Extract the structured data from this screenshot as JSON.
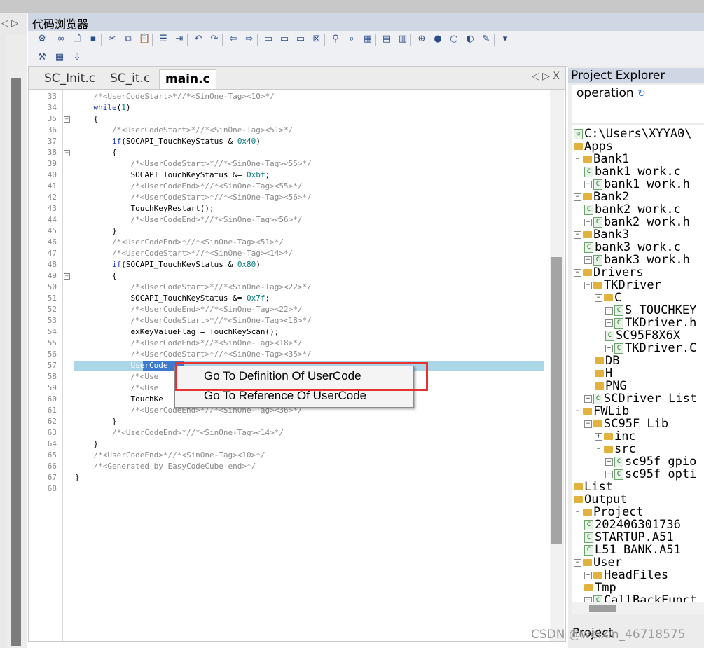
{
  "window": {
    "title": "代码浏览器",
    "left_nav_arrows": "◁ ▷"
  },
  "editor": {
    "tabs": [
      {
        "label": "SC_Init.c",
        "active": false
      },
      {
        "label": "SC_it.c",
        "active": false
      },
      {
        "label": "main.c",
        "active": true
      }
    ],
    "tab_controls": "◁ ▷ X",
    "lines": [
      {
        "n": "33",
        "fold": "",
        "code": "    /*<UserCodeStart>*//*<SinOne-Tag><10>*/"
      },
      {
        "n": "34",
        "fold": "",
        "code": "    while(1)"
      },
      {
        "n": "35",
        "fold": "−",
        "code": "    {"
      },
      {
        "n": "36",
        "fold": "",
        "code": "        /*<UserCodeStart>*//*<SinOne-Tag><51>*/"
      },
      {
        "n": "37",
        "fold": "",
        "code": "        if(SOCAPI_TouchKeyStatus & 0x40)"
      },
      {
        "n": "38",
        "fold": "−",
        "code": "        {"
      },
      {
        "n": "39",
        "fold": "",
        "code": "            /*<UserCodeStart>*//*<SinOne-Tag><55>*/"
      },
      {
        "n": "40",
        "fold": "",
        "code": "            SOCAPI_TouchKeyStatus &= 0xbf;"
      },
      {
        "n": "41",
        "fold": "",
        "code": "            /*<UserCodeEnd>*//*<SinOne-Tag><55>*/"
      },
      {
        "n": "42",
        "fold": "",
        "code": "            /*<UserCodeStart>*//*<SinOne-Tag><56>*/"
      },
      {
        "n": "43",
        "fold": "",
        "code": "            TouchKeyRestart();"
      },
      {
        "n": "44",
        "fold": "",
        "code": "            /*<UserCodeEnd>*//*<SinOne-Tag><56>*/"
      },
      {
        "n": "45",
        "fold": "",
        "code": "        }"
      },
      {
        "n": "46",
        "fold": "",
        "code": "        /*<UserCodeEnd>*//*<SinOne-Tag><51>*/"
      },
      {
        "n": "47",
        "fold": "",
        "code": "        /*<UserCodeStart>*//*<SinOne-Tag><14>*/"
      },
      {
        "n": "48",
        "fold": "",
        "code": "        if(SOCAPI_TouchKeyStatus & 0x80)"
      },
      {
        "n": "49",
        "fold": "−",
        "code": "        {"
      },
      {
        "n": "50",
        "fold": "",
        "code": "            /*<UserCodeStart>*//*<SinOne-Tag><22>*/"
      },
      {
        "n": "51",
        "fold": "",
        "code": "            SOCAPI_TouchKeyStatus &= 0x7f;"
      },
      {
        "n": "52",
        "fold": "",
        "code": "            /*<UserCodeEnd>*//*<SinOne-Tag><22>*/"
      },
      {
        "n": "53",
        "fold": "",
        "code": "            /*<UserCodeStart>*//*<SinOne-Tag><18>*/"
      },
      {
        "n": "54",
        "fold": "",
        "code": "            exKeyValueFlag = TouchKeyScan();"
      },
      {
        "n": "55",
        "fold": "",
        "code": "            /*<UserCodeEnd>*//*<SinOne-Tag><18>*/"
      },
      {
        "n": "56",
        "fold": "",
        "code": "            /*<UserCodeStart>*//*<SinOne-Tag><35>*/"
      },
      {
        "n": "57",
        "fold": "",
        "code": "            UserCode"
      },
      {
        "n": "58",
        "fold": "",
        "code": "            /*<Use"
      },
      {
        "n": "59",
        "fold": "",
        "code": "            /*<Use"
      },
      {
        "n": "60",
        "fold": "",
        "code": "            TouchKe"
      },
      {
        "n": "61",
        "fold": "",
        "code": "            /*<UserCodeEnd>*//*<SinOne-Tag><36>*/"
      },
      {
        "n": "62",
        "fold": "",
        "code": "        }"
      },
      {
        "n": "63",
        "fold": "",
        "code": "        /*<UserCodeEnd>*//*<SinOne-Tag><14>*/"
      },
      {
        "n": "64",
        "fold": "",
        "code": "    }"
      },
      {
        "n": "65",
        "fold": "",
        "code": "    /*<UserCodeEnd>*//*<SinOne-Tag><10>*/"
      },
      {
        "n": "66",
        "fold": "",
        "code": "    /*<Generated by EasyCodeCube end>*/"
      },
      {
        "n": "67",
        "fold": "",
        "code": "}"
      },
      {
        "n": "68",
        "fold": "",
        "code": ""
      }
    ],
    "selected_word": "UserCode"
  },
  "context_menu": {
    "items": [
      {
        "label": "Go To Definition Of UserCode",
        "highlighted": true
      },
      {
        "label": "Go To Reference Of UserCode",
        "highlighted": false
      }
    ]
  },
  "project_explorer": {
    "title": "Project Explorer",
    "operation_label": "operation",
    "bottom_tab": "Project",
    "tree": [
      {
        "depth": 0,
        "type": "root",
        "toggle": "",
        "label": "C:\\Users\\XYYA0\\"
      },
      {
        "depth": 0,
        "type": "folder",
        "toggle": "",
        "label": "Apps"
      },
      {
        "depth": 0,
        "type": "folder",
        "toggle": "−",
        "label": "Bank1"
      },
      {
        "depth": 1,
        "type": "file",
        "toggle": "",
        "label": "bank1 work.c"
      },
      {
        "depth": 1,
        "type": "file",
        "toggle": "+",
        "label": "bank1 work.h"
      },
      {
        "depth": 0,
        "type": "folder",
        "toggle": "−",
        "label": "Bank2"
      },
      {
        "depth": 1,
        "type": "file",
        "toggle": "",
        "label": "bank2 work.c"
      },
      {
        "depth": 1,
        "type": "file",
        "toggle": "+",
        "label": "bank2 work.h"
      },
      {
        "depth": 0,
        "type": "folder",
        "toggle": "−",
        "label": "Bank3"
      },
      {
        "depth": 1,
        "type": "file",
        "toggle": "",
        "label": "bank3 work.c"
      },
      {
        "depth": 1,
        "type": "file",
        "toggle": "+",
        "label": "bank3 work.h"
      },
      {
        "depth": 0,
        "type": "folder",
        "toggle": "−",
        "label": "Drivers"
      },
      {
        "depth": 1,
        "type": "folder",
        "toggle": "−",
        "label": "TKDriver"
      },
      {
        "depth": 2,
        "type": "folder",
        "toggle": "−",
        "label": "C"
      },
      {
        "depth": 3,
        "type": "file",
        "toggle": "+",
        "label": "S TOUCHKEY"
      },
      {
        "depth": 3,
        "type": "file",
        "toggle": "+",
        "label": "TKDriver.h"
      },
      {
        "depth": 3,
        "type": "file",
        "toggle": "",
        "label": "SC95F8X6X"
      },
      {
        "depth": 3,
        "type": "file",
        "toggle": "+",
        "label": "TKDriver.C"
      },
      {
        "depth": 2,
        "type": "folder",
        "toggle": "",
        "label": "DB"
      },
      {
        "depth": 2,
        "type": "folder",
        "toggle": "",
        "label": "H"
      },
      {
        "depth": 2,
        "type": "folder",
        "toggle": "",
        "label": "PNG"
      },
      {
        "depth": 1,
        "type": "file",
        "toggle": "+",
        "label": "SCDriver List"
      },
      {
        "depth": 0,
        "type": "folder",
        "toggle": "−",
        "label": "FWLib"
      },
      {
        "depth": 1,
        "type": "folder",
        "toggle": "−",
        "label": "SC95F Lib"
      },
      {
        "depth": 2,
        "type": "folder",
        "toggle": "+",
        "label": "inc"
      },
      {
        "depth": 2,
        "type": "folder",
        "toggle": "−",
        "label": "src"
      },
      {
        "depth": 3,
        "type": "file",
        "toggle": "+",
        "label": "sc95f gpio"
      },
      {
        "depth": 3,
        "type": "file",
        "toggle": "+",
        "label": "sc95f opti"
      },
      {
        "depth": 0,
        "type": "folder",
        "toggle": "",
        "label": "List"
      },
      {
        "depth": 0,
        "type": "folder",
        "toggle": "",
        "label": "Output"
      },
      {
        "depth": 0,
        "type": "folder",
        "toggle": "−",
        "label": "Project"
      },
      {
        "depth": 1,
        "type": "file",
        "toggle": "",
        "label": "202406301736"
      },
      {
        "depth": 1,
        "type": "file",
        "toggle": "",
        "label": "STARTUP.A51"
      },
      {
        "depth": 1,
        "type": "file",
        "toggle": "",
        "label": "L51 BANK.A51"
      },
      {
        "depth": 0,
        "type": "folder",
        "toggle": "−",
        "label": "User"
      },
      {
        "depth": 1,
        "type": "folder",
        "toggle": "+",
        "label": "HeadFiles"
      },
      {
        "depth": 1,
        "type": "folder",
        "toggle": "",
        "label": "Tmp"
      },
      {
        "depth": 1,
        "type": "file",
        "toggle": "+",
        "label": "CallBackFunct"
      }
    ]
  },
  "toolbar": {
    "row1_icons": [
      "settings-icon",
      "link-icon",
      "new-file-icon",
      "save-icon",
      "cut-icon",
      "copy-icon",
      "paste-icon",
      "list-icon",
      "indent-icon",
      "undo-icon",
      "redo-icon",
      "arrow-left-icon",
      "arrow-right-icon",
      "comment-icon",
      "comment-icon",
      "comment-add-icon",
      "comment-remove-icon",
      "binoculars-icon",
      "find-icon",
      "find-in-files-icon",
      "window-icon",
      "window-split-icon",
      "search-zoom-icon",
      "dot-icon",
      "gray-dot-icon",
      "paint-icon",
      "tool-icon",
      "dropdown-icon"
    ],
    "row2_icons": [
      "build-icon",
      "grid-icon",
      "load-icon"
    ]
  },
  "watermark": "CSDN @weixin_46718575",
  "colors": {
    "accent": "#3d7bd0",
    "highlight_row": "#abd6e8",
    "red_box": "#e53232"
  }
}
